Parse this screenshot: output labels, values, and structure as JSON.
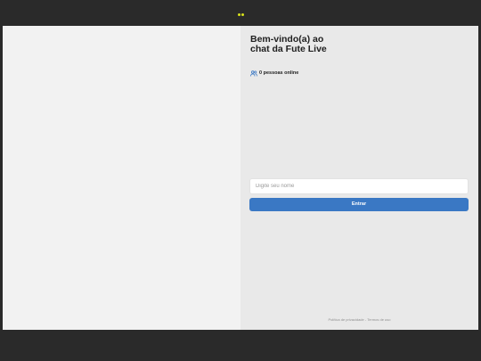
{
  "header": {
    "logo_icon": "logo-dots-icon",
    "accent": "#d8e21a"
  },
  "chat": {
    "title": "Bem-vindo(a) ao chat da Fute Live",
    "online_icon": "people-icon",
    "online_text": "0 pessoas online",
    "name_placeholder": "Digite seu nome",
    "name_value": "",
    "enter_label": "Entrar",
    "button_color": "#3a78c4"
  },
  "footer": {
    "privacy_label": "Política de privacidade",
    "separator": "-",
    "terms_label": "Termos de uso"
  }
}
